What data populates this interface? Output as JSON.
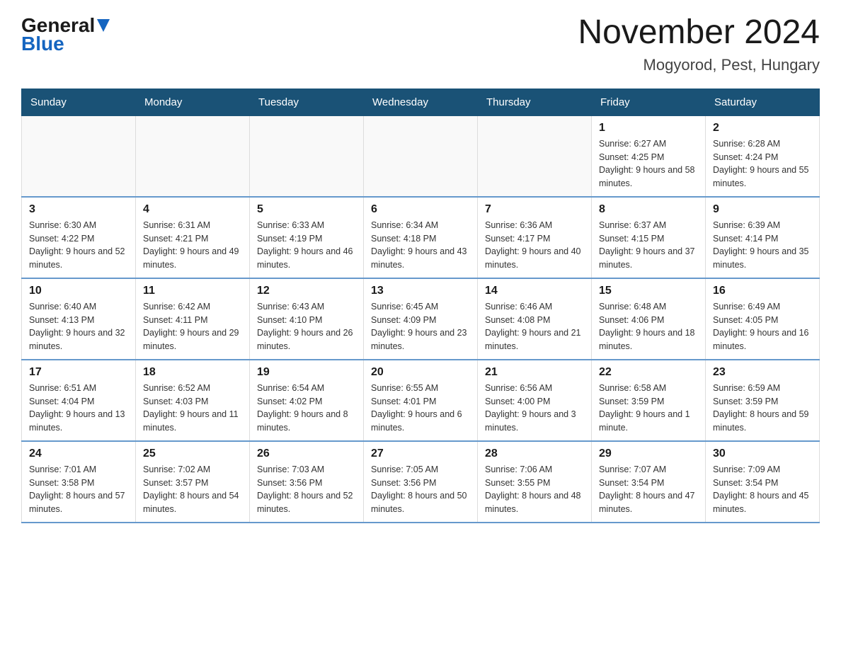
{
  "logo": {
    "general": "General",
    "blue": "Blue"
  },
  "title": "November 2024",
  "subtitle": "Mogyorod, Pest, Hungary",
  "days_of_week": [
    "Sunday",
    "Monday",
    "Tuesday",
    "Wednesday",
    "Thursday",
    "Friday",
    "Saturday"
  ],
  "weeks": [
    [
      {
        "day": "",
        "info": ""
      },
      {
        "day": "",
        "info": ""
      },
      {
        "day": "",
        "info": ""
      },
      {
        "day": "",
        "info": ""
      },
      {
        "day": "",
        "info": ""
      },
      {
        "day": "1",
        "info": "Sunrise: 6:27 AM\nSunset: 4:25 PM\nDaylight: 9 hours and 58 minutes."
      },
      {
        "day": "2",
        "info": "Sunrise: 6:28 AM\nSunset: 4:24 PM\nDaylight: 9 hours and 55 minutes."
      }
    ],
    [
      {
        "day": "3",
        "info": "Sunrise: 6:30 AM\nSunset: 4:22 PM\nDaylight: 9 hours and 52 minutes."
      },
      {
        "day": "4",
        "info": "Sunrise: 6:31 AM\nSunset: 4:21 PM\nDaylight: 9 hours and 49 minutes."
      },
      {
        "day": "5",
        "info": "Sunrise: 6:33 AM\nSunset: 4:19 PM\nDaylight: 9 hours and 46 minutes."
      },
      {
        "day": "6",
        "info": "Sunrise: 6:34 AM\nSunset: 4:18 PM\nDaylight: 9 hours and 43 minutes."
      },
      {
        "day": "7",
        "info": "Sunrise: 6:36 AM\nSunset: 4:17 PM\nDaylight: 9 hours and 40 minutes."
      },
      {
        "day": "8",
        "info": "Sunrise: 6:37 AM\nSunset: 4:15 PM\nDaylight: 9 hours and 37 minutes."
      },
      {
        "day": "9",
        "info": "Sunrise: 6:39 AM\nSunset: 4:14 PM\nDaylight: 9 hours and 35 minutes."
      }
    ],
    [
      {
        "day": "10",
        "info": "Sunrise: 6:40 AM\nSunset: 4:13 PM\nDaylight: 9 hours and 32 minutes."
      },
      {
        "day": "11",
        "info": "Sunrise: 6:42 AM\nSunset: 4:11 PM\nDaylight: 9 hours and 29 minutes."
      },
      {
        "day": "12",
        "info": "Sunrise: 6:43 AM\nSunset: 4:10 PM\nDaylight: 9 hours and 26 minutes."
      },
      {
        "day": "13",
        "info": "Sunrise: 6:45 AM\nSunset: 4:09 PM\nDaylight: 9 hours and 23 minutes."
      },
      {
        "day": "14",
        "info": "Sunrise: 6:46 AM\nSunset: 4:08 PM\nDaylight: 9 hours and 21 minutes."
      },
      {
        "day": "15",
        "info": "Sunrise: 6:48 AM\nSunset: 4:06 PM\nDaylight: 9 hours and 18 minutes."
      },
      {
        "day": "16",
        "info": "Sunrise: 6:49 AM\nSunset: 4:05 PM\nDaylight: 9 hours and 16 minutes."
      }
    ],
    [
      {
        "day": "17",
        "info": "Sunrise: 6:51 AM\nSunset: 4:04 PM\nDaylight: 9 hours and 13 minutes."
      },
      {
        "day": "18",
        "info": "Sunrise: 6:52 AM\nSunset: 4:03 PM\nDaylight: 9 hours and 11 minutes."
      },
      {
        "day": "19",
        "info": "Sunrise: 6:54 AM\nSunset: 4:02 PM\nDaylight: 9 hours and 8 minutes."
      },
      {
        "day": "20",
        "info": "Sunrise: 6:55 AM\nSunset: 4:01 PM\nDaylight: 9 hours and 6 minutes."
      },
      {
        "day": "21",
        "info": "Sunrise: 6:56 AM\nSunset: 4:00 PM\nDaylight: 9 hours and 3 minutes."
      },
      {
        "day": "22",
        "info": "Sunrise: 6:58 AM\nSunset: 3:59 PM\nDaylight: 9 hours and 1 minute."
      },
      {
        "day": "23",
        "info": "Sunrise: 6:59 AM\nSunset: 3:59 PM\nDaylight: 8 hours and 59 minutes."
      }
    ],
    [
      {
        "day": "24",
        "info": "Sunrise: 7:01 AM\nSunset: 3:58 PM\nDaylight: 8 hours and 57 minutes."
      },
      {
        "day": "25",
        "info": "Sunrise: 7:02 AM\nSunset: 3:57 PM\nDaylight: 8 hours and 54 minutes."
      },
      {
        "day": "26",
        "info": "Sunrise: 7:03 AM\nSunset: 3:56 PM\nDaylight: 8 hours and 52 minutes."
      },
      {
        "day": "27",
        "info": "Sunrise: 7:05 AM\nSunset: 3:56 PM\nDaylight: 8 hours and 50 minutes."
      },
      {
        "day": "28",
        "info": "Sunrise: 7:06 AM\nSunset: 3:55 PM\nDaylight: 8 hours and 48 minutes."
      },
      {
        "day": "29",
        "info": "Sunrise: 7:07 AM\nSunset: 3:54 PM\nDaylight: 8 hours and 47 minutes."
      },
      {
        "day": "30",
        "info": "Sunrise: 7:09 AM\nSunset: 3:54 PM\nDaylight: 8 hours and 45 minutes."
      }
    ]
  ]
}
